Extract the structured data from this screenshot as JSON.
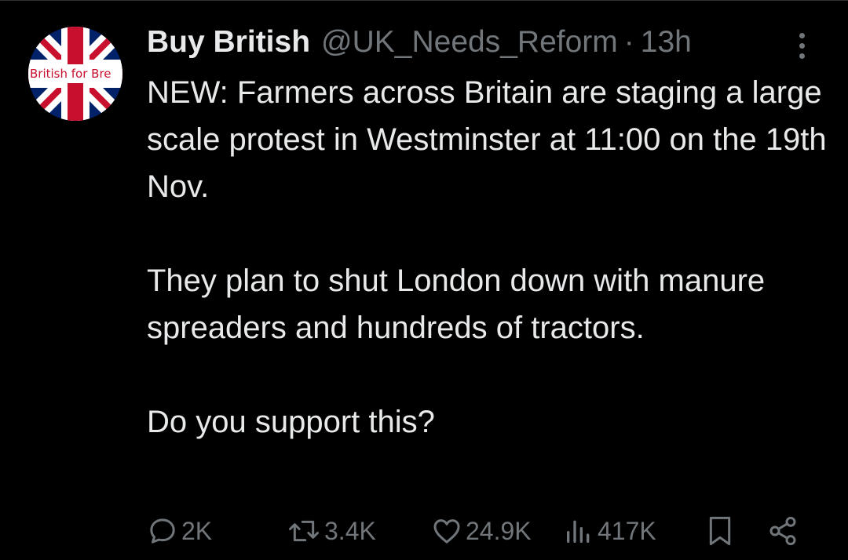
{
  "author": {
    "display_name": "Buy British",
    "handle": "@UK_Needs_Reform",
    "separator": "·",
    "time": "13h",
    "avatar_text": "British for Bre"
  },
  "tweet": {
    "paragraphs": [
      "NEW: Farmers across Britain are staging a large scale protest in Westminster at 11:00 on the 19th Nov.",
      "They plan to shut London down with manure spreaders and hundreds of tractors.",
      "Do you support this?"
    ]
  },
  "actions": {
    "replies": "2K",
    "reposts": "3.4K",
    "likes": "24.9K",
    "views": "417K"
  },
  "icons": {
    "reply": "reply-icon",
    "repost": "repost-icon",
    "like": "heart-icon",
    "views": "views-icon",
    "bookmark": "bookmark-icon",
    "share": "share-icon",
    "more": "more-icon"
  },
  "colors": {
    "background": "#000000",
    "text_primary": "#e7e9ea",
    "text_secondary": "#71767b",
    "flag_blue": "#012169",
    "flag_red": "#c8102e"
  }
}
